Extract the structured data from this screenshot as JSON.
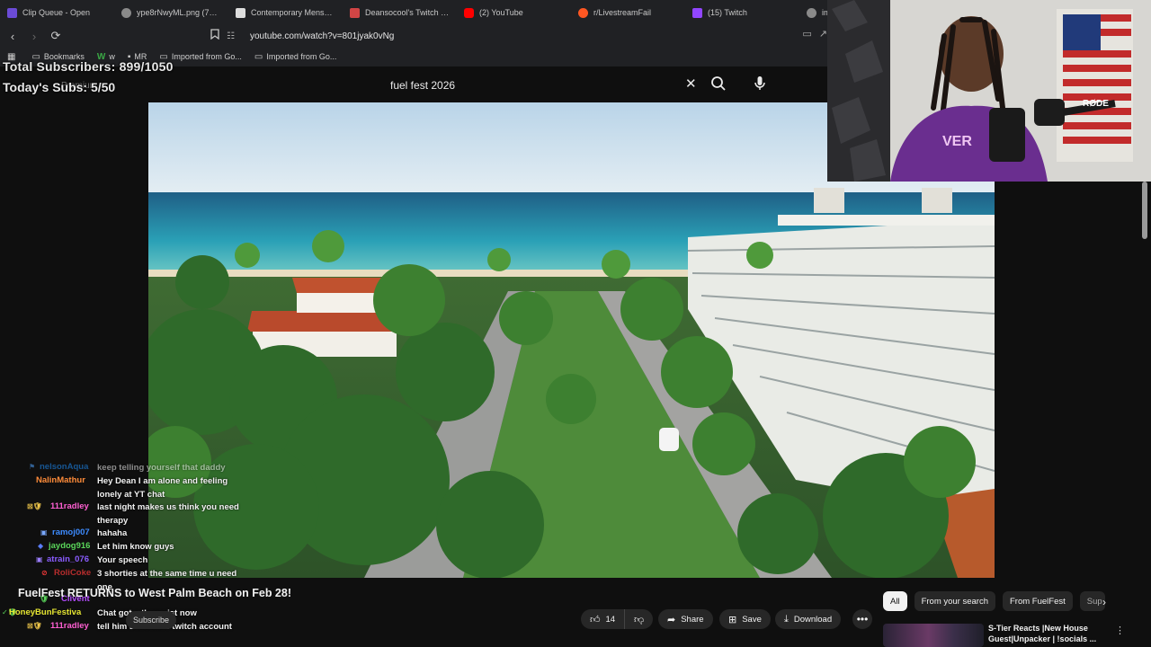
{
  "browser": {
    "tabs": [
      {
        "title": "Clip Queue - Open",
        "color": "#6b4bd6"
      },
      {
        "title": "ype8rNwyML.png (759×1",
        "color": "#8a8a8a"
      },
      {
        "title": "Contemporary Menswear",
        "color": "#dddddd"
      },
      {
        "title": "Deansocool's Twitch Stati",
        "color": "#d14545"
      },
      {
        "title": "(2) YouTube",
        "color": "#ff0000"
      },
      {
        "title": "r/LivestreamFail",
        "color": "#ff5722"
      },
      {
        "title": "(15) Twitch",
        "color": "#9146ff"
      },
      {
        "title": "im",
        "color": "#8a8a8a"
      }
    ],
    "url": "youtube.com/watch?v=801jyak0vNg",
    "bookmarks": [
      {
        "label": "Bookmarks",
        "icon": "folder-icon"
      },
      {
        "label": "w",
        "icon": "w-logo-icon"
      },
      {
        "label": "MR",
        "icon": "mr-icon"
      },
      {
        "label": "Imported from Go...",
        "icon": "folder-icon"
      },
      {
        "label": "Imported from Go...",
        "icon": "folder-icon"
      }
    ]
  },
  "overlay": {
    "total_subscribers": "Total Subscribers: 899/1050",
    "today_subs": "Today's Subs: 5/50",
    "ghost_label": "Premium"
  },
  "search": {
    "query": "fuel fest 2026"
  },
  "chat": [
    {
      "user": "nelsonAqua",
      "text": "keep telling yourself that daddy",
      "color": "#1e90ff",
      "badge": "⚑"
    },
    {
      "user": "NalinMathur",
      "text": "Hey Dean I am alone and feeling lonely at YT chat",
      "color": "#ff8c3a",
      "badge": ""
    },
    {
      "user": "111radley",
      "text": "last night makes us think you need therapy",
      "color": "#ff5fd2",
      "badge": "⊠🛡"
    },
    {
      "user": "ramoj007",
      "text": "hahaha",
      "color": "#3d8bff",
      "badge": "▣"
    },
    {
      "user": "jaydog916",
      "text": "Let him know guys",
      "color": "#5ad65a",
      "badge": "◆"
    },
    {
      "user": "atrain_076",
      "text": "Your speech",
      "color": "#8a5cff",
      "badge": "▣"
    },
    {
      "user": "RoliCoke",
      "text": "3 shorties at the same time u need one",
      "color": "#ff3b3b",
      "badge": "⊘"
    },
    {
      "user": "Clivent",
      "text": "",
      "color": "#b44cff",
      "badge": "🛡"
    },
    {
      "user": "HoneyBunFestiva",
      "text": "Chat got a therapist now",
      "color": "#e6e632",
      "badge": "✓🛡"
    },
    {
      "user": "111radley",
      "text": "tell him subscribe twitch account",
      "color": "#ff5fd2",
      "badge": "⊠🛡"
    }
  ],
  "video": {
    "title": "FuelFest RETURNS to West Palm Beach on Feb 28!",
    "subscribe_label": "Subscribe",
    "likes": "14",
    "share_label": "Share",
    "save_label": "Save",
    "download_label": "Download"
  },
  "sidebar": {
    "chips": [
      "All",
      "From your search",
      "From FuelFest",
      "Sup"
    ],
    "recommendation": {
      "title": "S-Tier Reacts |New House Guest|Unpacker | !socials ..."
    }
  },
  "colors": {
    "bg": "#0f0f0f",
    "chrome": "#202124",
    "pill": "#272727",
    "overlay_red": "#c62121"
  }
}
